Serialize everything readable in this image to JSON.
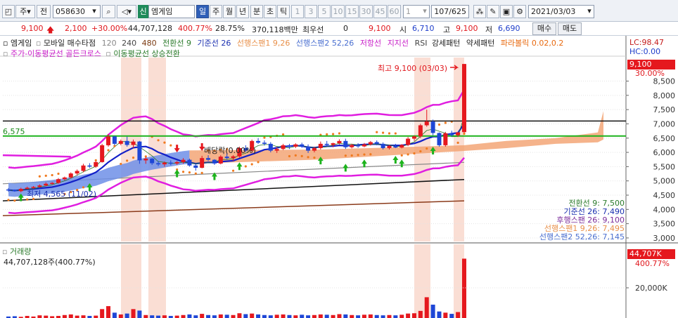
{
  "toolbar": {
    "btn_weekly": "주",
    "btn_prev": "전",
    "code": "058630",
    "badge": "신",
    "name": "엠게임",
    "periods": [
      "일",
      "주",
      "월",
      "년",
      "분",
      "초",
      "틱"
    ],
    "minutes": [
      "1",
      "3",
      "5",
      "10",
      "15",
      "30",
      "45",
      "60"
    ],
    "count": "1",
    "range": "107/625",
    "date": "2021/03/03"
  },
  "quote": {
    "price": "9,100",
    "change": "2,100",
    "change_pct": "+30.00%",
    "volume": "44,707,128",
    "vol_ratio": "400.77%",
    "turnover": "28.75%",
    "amount": "370,118백만",
    "pref_label": "최우선",
    "pref_value": "0",
    "ask": "9,100",
    "open_label": "시",
    "open": "6,710",
    "high_label": "고",
    "high": "9,100",
    "low_label": "저",
    "low": "6,690",
    "buy": "매수",
    "sell": "매도"
  },
  "legend": {
    "row1": [
      "엠게임",
      "모바일 매수타점",
      "120",
      "240",
      "480",
      "전환선 9",
      "기준선 26",
      "선행스팬1 9,26",
      "선행스팬2 52,26",
      "저항선",
      "지지선",
      "RSI",
      "강세패턴",
      "약세패턴",
      "파라볼릭 0.02,0.2"
    ],
    "row2": [
      "주가-이동평균선 골든크로스",
      "이동평균선 상승전환"
    ],
    "lc": "LC:98.47",
    "hc": "HC:0.00",
    "volume_title": "거래량",
    "volume_value": "44,707,128주(400.77%)"
  },
  "labels": {
    "high": "최고 9,100 (03/03)",
    "low": "최저 4,565 (11/02)",
    "ex_div": "배당락(0.00%)",
    "line_value": "6,575",
    "cur_price": "9,100",
    "cur_pct": "30.00%",
    "vol_tag": "44,707K",
    "vol_pct": "400.77%",
    "vol_axis": "20,000K"
  },
  "ichimoku_values": [
    {
      "label": "전환선 9: 7,500",
      "color": "#2a7a2a"
    },
    {
      "label": "기준선 26: 7,490",
      "color": "#1a2fb0"
    },
    {
      "label": "후행스팬 26: 9,100",
      "color": "#7a2a9a"
    },
    {
      "label": "선행스팬1 9,26: 7,495",
      "color": "#e8904a"
    },
    {
      "label": "선행스팬2 52,26: 7,145",
      "color": "#4a6fd0"
    }
  ],
  "colors": {
    "up": "#e5181e",
    "down": "#1e46d6",
    "envelope": "#e01ee0",
    "base": "#1320c8",
    "green": "#1db31d",
    "cloud_up": "#f2a06e",
    "cloud_down": "#6f8fe8",
    "highlight": "#f6c8b8"
  },
  "chart_data": {
    "type": "candlestick",
    "yaxis_ticks": [
      3000,
      3500,
      4000,
      4500,
      5000,
      5500,
      6000,
      6500,
      7000,
      7500,
      8000,
      8500
    ],
    "ylim": [
      2900,
      9300
    ],
    "candles": [
      [
        4700,
        4750,
        4620,
        4680
      ],
      [
        4680,
        4700,
        4620,
        4640
      ],
      [
        4640,
        4760,
        4600,
        4720
      ],
      [
        4720,
        4800,
        4700,
        4760
      ],
      [
        4760,
        4820,
        4720,
        4790
      ],
      [
        4790,
        4880,
        4760,
        4840
      ],
      [
        4840,
        4950,
        4810,
        4900
      ],
      [
        4900,
        4960,
        4860,
        4930
      ],
      [
        4930,
        5100,
        4900,
        5060
      ],
      [
        5060,
        5150,
        5020,
        5120
      ],
      [
        5120,
        5300,
        5080,
        5260
      ],
      [
        5260,
        5400,
        5200,
        5350
      ],
      [
        5350,
        5600,
        5300,
        5540
      ],
      [
        5540,
        5620,
        5460,
        5500
      ],
      [
        5500,
        5700,
        5460,
        5660
      ],
      [
        5660,
        6300,
        5640,
        6250
      ],
      [
        6250,
        6640,
        6200,
        6560
      ],
      [
        6560,
        6580,
        6250,
        6300
      ],
      [
        6300,
        6450,
        6250,
        6400
      ],
      [
        6400,
        6550,
        6200,
        6260
      ],
      [
        6260,
        6450,
        6150,
        6380
      ],
      [
        6380,
        6400,
        5600,
        5720
      ],
      [
        5720,
        5840,
        5600,
        5780
      ],
      [
        5780,
        5800,
        5560,
        5620
      ],
      [
        5620,
        5700,
        5520,
        5580
      ],
      [
        5580,
        5680,
        5500,
        5640
      ],
      [
        5640,
        5720,
        5550,
        5610
      ],
      [
        5610,
        5700,
        5560,
        5660
      ],
      [
        5660,
        5800,
        5600,
        5740
      ],
      [
        5740,
        5780,
        5500,
        5540
      ],
      [
        5540,
        5600,
        5360,
        5460
      ],
      [
        5460,
        5880,
        5440,
        5800
      ],
      [
        5800,
        5900,
        5700,
        5740
      ],
      [
        5740,
        5760,
        5560,
        5610
      ],
      [
        5610,
        5900,
        5580,
        5850
      ],
      [
        5850,
        5960,
        5750,
        5800
      ],
      [
        5800,
        5900,
        5700,
        5860
      ],
      [
        5860,
        6200,
        5820,
        6150
      ],
      [
        6150,
        6250,
        6000,
        6060
      ],
      [
        6060,
        6450,
        6020,
        6400
      ],
      [
        6400,
        6500,
        6300,
        6340
      ],
      [
        6340,
        6420,
        6240,
        6300
      ],
      [
        6300,
        6360,
        6000,
        6060
      ],
      [
        6060,
        6180,
        5980,
        6120
      ],
      [
        6120,
        6300,
        6080,
        6250
      ],
      [
        6250,
        6300,
        6120,
        6200
      ],
      [
        6200,
        6320,
        6150,
        6280
      ],
      [
        6280,
        6340,
        6160,
        6200
      ],
      [
        6200,
        6280,
        5980,
        6060
      ],
      [
        6060,
        6200,
        6000,
        6150
      ],
      [
        6150,
        6380,
        6100,
        6300
      ],
      [
        6300,
        6400,
        6200,
        6260
      ],
      [
        6260,
        6340,
        6180,
        6320
      ],
      [
        6320,
        6460,
        6280,
        6400
      ],
      [
        6400,
        6480,
        6120,
        6180
      ],
      [
        6180,
        6300,
        6140,
        6260
      ],
      [
        6260,
        6320,
        6160,
        6210
      ],
      [
        6210,
        6330,
        6180,
        6280
      ],
      [
        6280,
        6400,
        6240,
        6360
      ],
      [
        6360,
        6420,
        6250,
        6300
      ],
      [
        6300,
        6350,
        6100,
        6150
      ],
      [
        6150,
        6260,
        6100,
        6230
      ],
      [
        6230,
        6300,
        6150,
        6170
      ],
      [
        6170,
        6290,
        6140,
        6260
      ],
      [
        6260,
        6540,
        6220,
        6480
      ],
      [
        6480,
        6600,
        6400,
        6560
      ],
      [
        6560,
        7000,
        6500,
        6950
      ],
      [
        6950,
        7500,
        6900,
        7080
      ],
      [
        7080,
        7150,
        6600,
        6680
      ],
      [
        6680,
        6700,
        6200,
        6250
      ],
      [
        6250,
        6720,
        6200,
        6670
      ],
      [
        6670,
        6760,
        6550,
        6600
      ],
      [
        6600,
        6720,
        6540,
        6700
      ],
      [
        6710,
        9100,
        6690,
        9100
      ]
    ],
    "volume": [
      5,
      6,
      4,
      7,
      5,
      9,
      8,
      6,
      7,
      10,
      12,
      8,
      9,
      7,
      8,
      30,
      40,
      18,
      12,
      15,
      30,
      25,
      10,
      9,
      8,
      9,
      7,
      8,
      10,
      12,
      9,
      14,
      10,
      9,
      12,
      11,
      10,
      16,
      13,
      15,
      12,
      10,
      9,
      11,
      12,
      10,
      9,
      11,
      9,
      10,
      12,
      11,
      10,
      13,
      12,
      10,
      9,
      11,
      12,
      10,
      9,
      10,
      9,
      11,
      15,
      16,
      24,
      70,
      45,
      22,
      18,
      14,
      20,
      200
    ],
    "vol_ymax": 220
  }
}
